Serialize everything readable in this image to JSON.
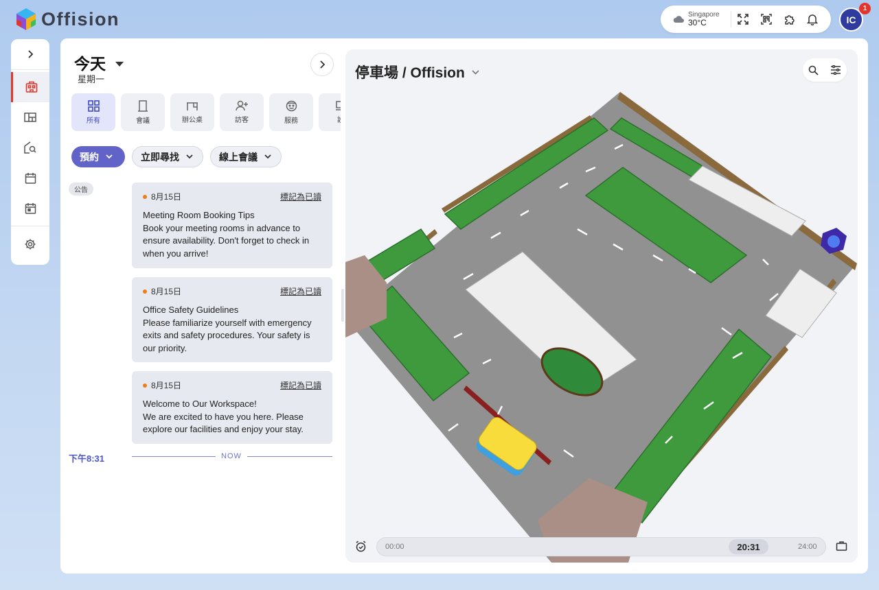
{
  "app": {
    "brand": "Offision"
  },
  "header": {
    "weather": {
      "city": "Singapore",
      "temp": "30°C",
      "icon": "cloud-icon"
    },
    "icons": [
      "fullscreen-icon",
      "qr-scan-icon",
      "puzzle-icon",
      "bell-icon"
    ],
    "avatar_initials": "IC",
    "notification_count": "1"
  },
  "rail": {
    "items": [
      {
        "name": "expand-icon"
      },
      {
        "name": "building-icon",
        "active": true
      },
      {
        "name": "floorplan-icon"
      },
      {
        "name": "find-icon"
      },
      {
        "name": "calendar-icon"
      },
      {
        "name": "calendar-check-icon"
      },
      {
        "name": "settings-icon"
      }
    ]
  },
  "schedule": {
    "title": "今天",
    "subtitle": "星期一",
    "categories": [
      {
        "label": "所有",
        "icon": "grid-icon",
        "active": true
      },
      {
        "label": "會議",
        "icon": "door-icon"
      },
      {
        "label": "辦公桌",
        "icon": "desk-icon"
      },
      {
        "label": "訪客",
        "icon": "visitor-icon"
      },
      {
        "label": "服務",
        "icon": "service-icon"
      },
      {
        "label": "設",
        "icon": "device-icon"
      }
    ],
    "actions": {
      "book": "預約",
      "find_now": "立即尋找",
      "online_meeting": "線上會議"
    },
    "announcement_tag": "公告",
    "mark_read": "標記為已讀",
    "announcements": [
      {
        "date": "8月15日",
        "title": "Meeting Room Booking Tips",
        "body": "Book your meeting rooms in advance to ensure availability. Don't forget to check in when you arrive!"
      },
      {
        "date": "8月15日",
        "title": "Office Safety Guidelines",
        "body": "Please familiarize yourself with emergency exits and safety procedures. Your safety is our priority."
      },
      {
        "date": "8月15日",
        "title": "Welcome to Our Workspace!",
        "body": "We are excited to have you here. Please explore our facilities and enjoy your stay."
      }
    ],
    "now_time": "下午8:31",
    "now_label": "NOW"
  },
  "map": {
    "title": "停車場 / Offision",
    "timeline": {
      "start": "00:00",
      "end": "24:00",
      "current": "20:31"
    },
    "colors": {
      "asphalt": "#8f8f8f",
      "parking_green": "#3f9a3e",
      "reserved_white": "#eeeeee",
      "car_yellow": "#f7dc3b",
      "wall_brown": "#a98f85"
    }
  }
}
